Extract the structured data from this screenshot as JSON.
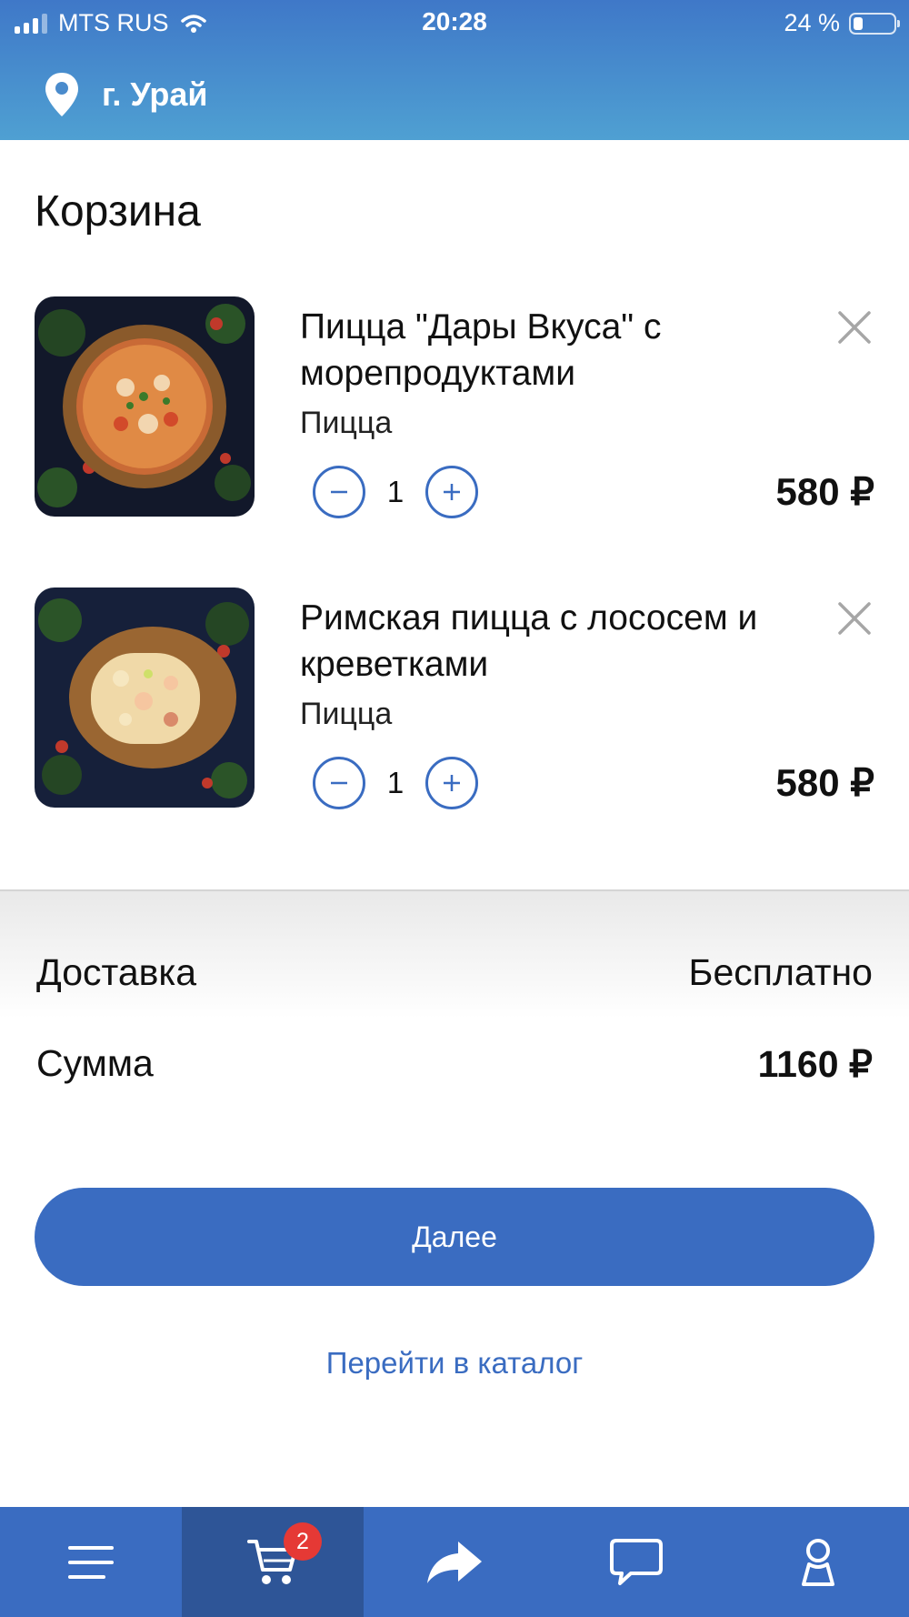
{
  "status_bar": {
    "carrier": "MTS RUS",
    "time": "20:28",
    "battery_text": "24 %",
    "battery_level": 0.24
  },
  "location": {
    "city": "г. Урай",
    "icon": "map-pin-icon"
  },
  "cart": {
    "title": "Корзина",
    "items": [
      {
        "name": "Пицца \"Дары Вкуса\" с морепродуктами",
        "category": "Пицца",
        "quantity": "1",
        "price": "580 ₽"
      },
      {
        "name": "Римская пицца с лососем и креветками",
        "category": "Пицца",
        "quantity": "1",
        "price": "580 ₽"
      }
    ]
  },
  "summary": {
    "delivery_label": "Доставка",
    "delivery_value": "Бесплатно",
    "total_label": "Сумма",
    "total_value": "1160 ₽"
  },
  "actions": {
    "next_label": "Далее",
    "catalog_label": "Перейти в каталог"
  },
  "tabbar": {
    "tabs": [
      {
        "icon": "menu-icon",
        "active": false
      },
      {
        "icon": "cart-icon",
        "active": true,
        "badge": "2"
      },
      {
        "icon": "share-icon",
        "active": false
      },
      {
        "icon": "chat-icon",
        "active": false
      },
      {
        "icon": "user-icon",
        "active": false
      }
    ]
  },
  "colors": {
    "accent": "#3a6cc1",
    "active_tab": "#2e5597",
    "badge": "#e53935",
    "header_top": "#3f78c8",
    "header_bottom": "#4fa0d2"
  }
}
